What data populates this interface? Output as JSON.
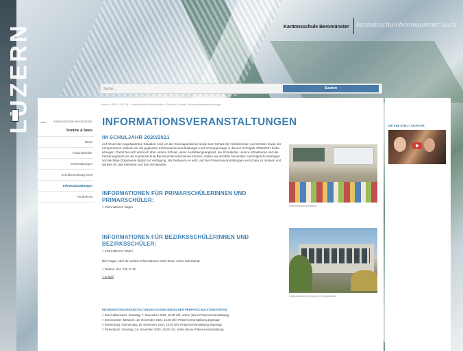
{
  "brand": {
    "kanton": "LUZERN",
    "school_name": "Kantonsschule Beromünster",
    "domain": "kantonsschuleberomuenster.lu.ch"
  },
  "search": {
    "placeholder": "Suche ...",
    "button_label": "Suchen"
  },
  "breadcrumb": "Kanton  >  BKD  >  DGYM  >  Kantonsschule Beromünster  >  Termine & News  >  Informationsveranstaltungen",
  "sidebar": {
    "top": "Kantonsschule Beromünster",
    "items": [
      {
        "label": "Termine & News",
        "style": "bold"
      },
      {
        "label": "News",
        "style": ""
      },
      {
        "label": "Kulturkalender",
        "style": ""
      },
      {
        "label": "Veranstaltungen",
        "style": ""
      },
      {
        "label": "Schulbesuchstag 2019",
        "style": ""
      },
      {
        "label": "Infoveranstaltungen",
        "style": "active"
      },
      {
        "label": "Kinderkrett",
        "style": ""
      }
    ]
  },
  "main": {
    "title": "INFORMATIONSVERANSTALTUNGEN",
    "section1_heading": "IM SCHULJAHR 2020/2021",
    "section1_text": "Auf Grund der angespannten Situation rund um die Coronapandemie sowie zum Schutz der Schülerinnen und Schüler sowie der Lehrpersonen müssen wir die geplanten Informationsveranstaltungen und Schnuppertage in diesem Schuljahr 2020/2021 leider absagen. Damit Sie sich dennoch über unsere Schule, unser Ausbildungsangebot, die Schulkultur, unsere Infrastruktur und die Förderangebote an der Kantonsschule Beromünster informieren können, stellen wir ab Mitte November nachfolgend Unterlagen und wichtige Dokumente digital zur Verfügung. Wir bedauern es sehr, auf die Präsenzveranstaltungen verzichten zu müssen und danken für das Interesse und das Verständnis.",
    "section2_heading_line1": "INFORMATIONEN FÜR PRIMARSCHÜLERINNEN UND",
    "section2_heading_line2": "PRIMARSCHÜLER:",
    "section2_link": "> Informationen folgen",
    "section3_heading_line1": "INFORMATIONEN FÜR BEZIRKSSCHÜLERINNEN UND",
    "section3_heading_line2": "BEZIRKSSCHÜLER:",
    "section3_link": "> Informationen folgen",
    "contact_text": "Bei Fragen oder für weitere Informationen steht Ihnen unser Sekretariat:",
    "phone": "> Telefon: 041 228 47 80",
    "email": "> E-Mail",
    "image1_caption": "Informationsveranstaltung",
    "image2_caption": "Kantonsschule Beromünster, Hauptgebäude",
    "bottom_heading": "INFORMATIONSVERANSTALTUNGEN AN DEN EINZELNEN PRIMARSCHULSTANDORTEN:",
    "events": [
      "> Rain/Hildisrieden: Samstag, 7. November 2020, 10.00 Uhr, online (keine Präsenzveranstaltung)",
      "> Beromünster: Mittwoch, 18. November 2020, 18.00 Uhr, Präsenzveranstaltung abgesagt",
      "> Rothenburg: Donnerstag, 19. November 2020, 19.30 Uhr, Präsenzveranstaltung abgesagt",
      "> Rickenbach: Dienstag, 24. November 2020, 19.00 Uhr, online (keine Präsenzveranstaltung)"
    ]
  },
  "right": {
    "video_title": "DIE KSB STELLT SICH VOR"
  }
}
